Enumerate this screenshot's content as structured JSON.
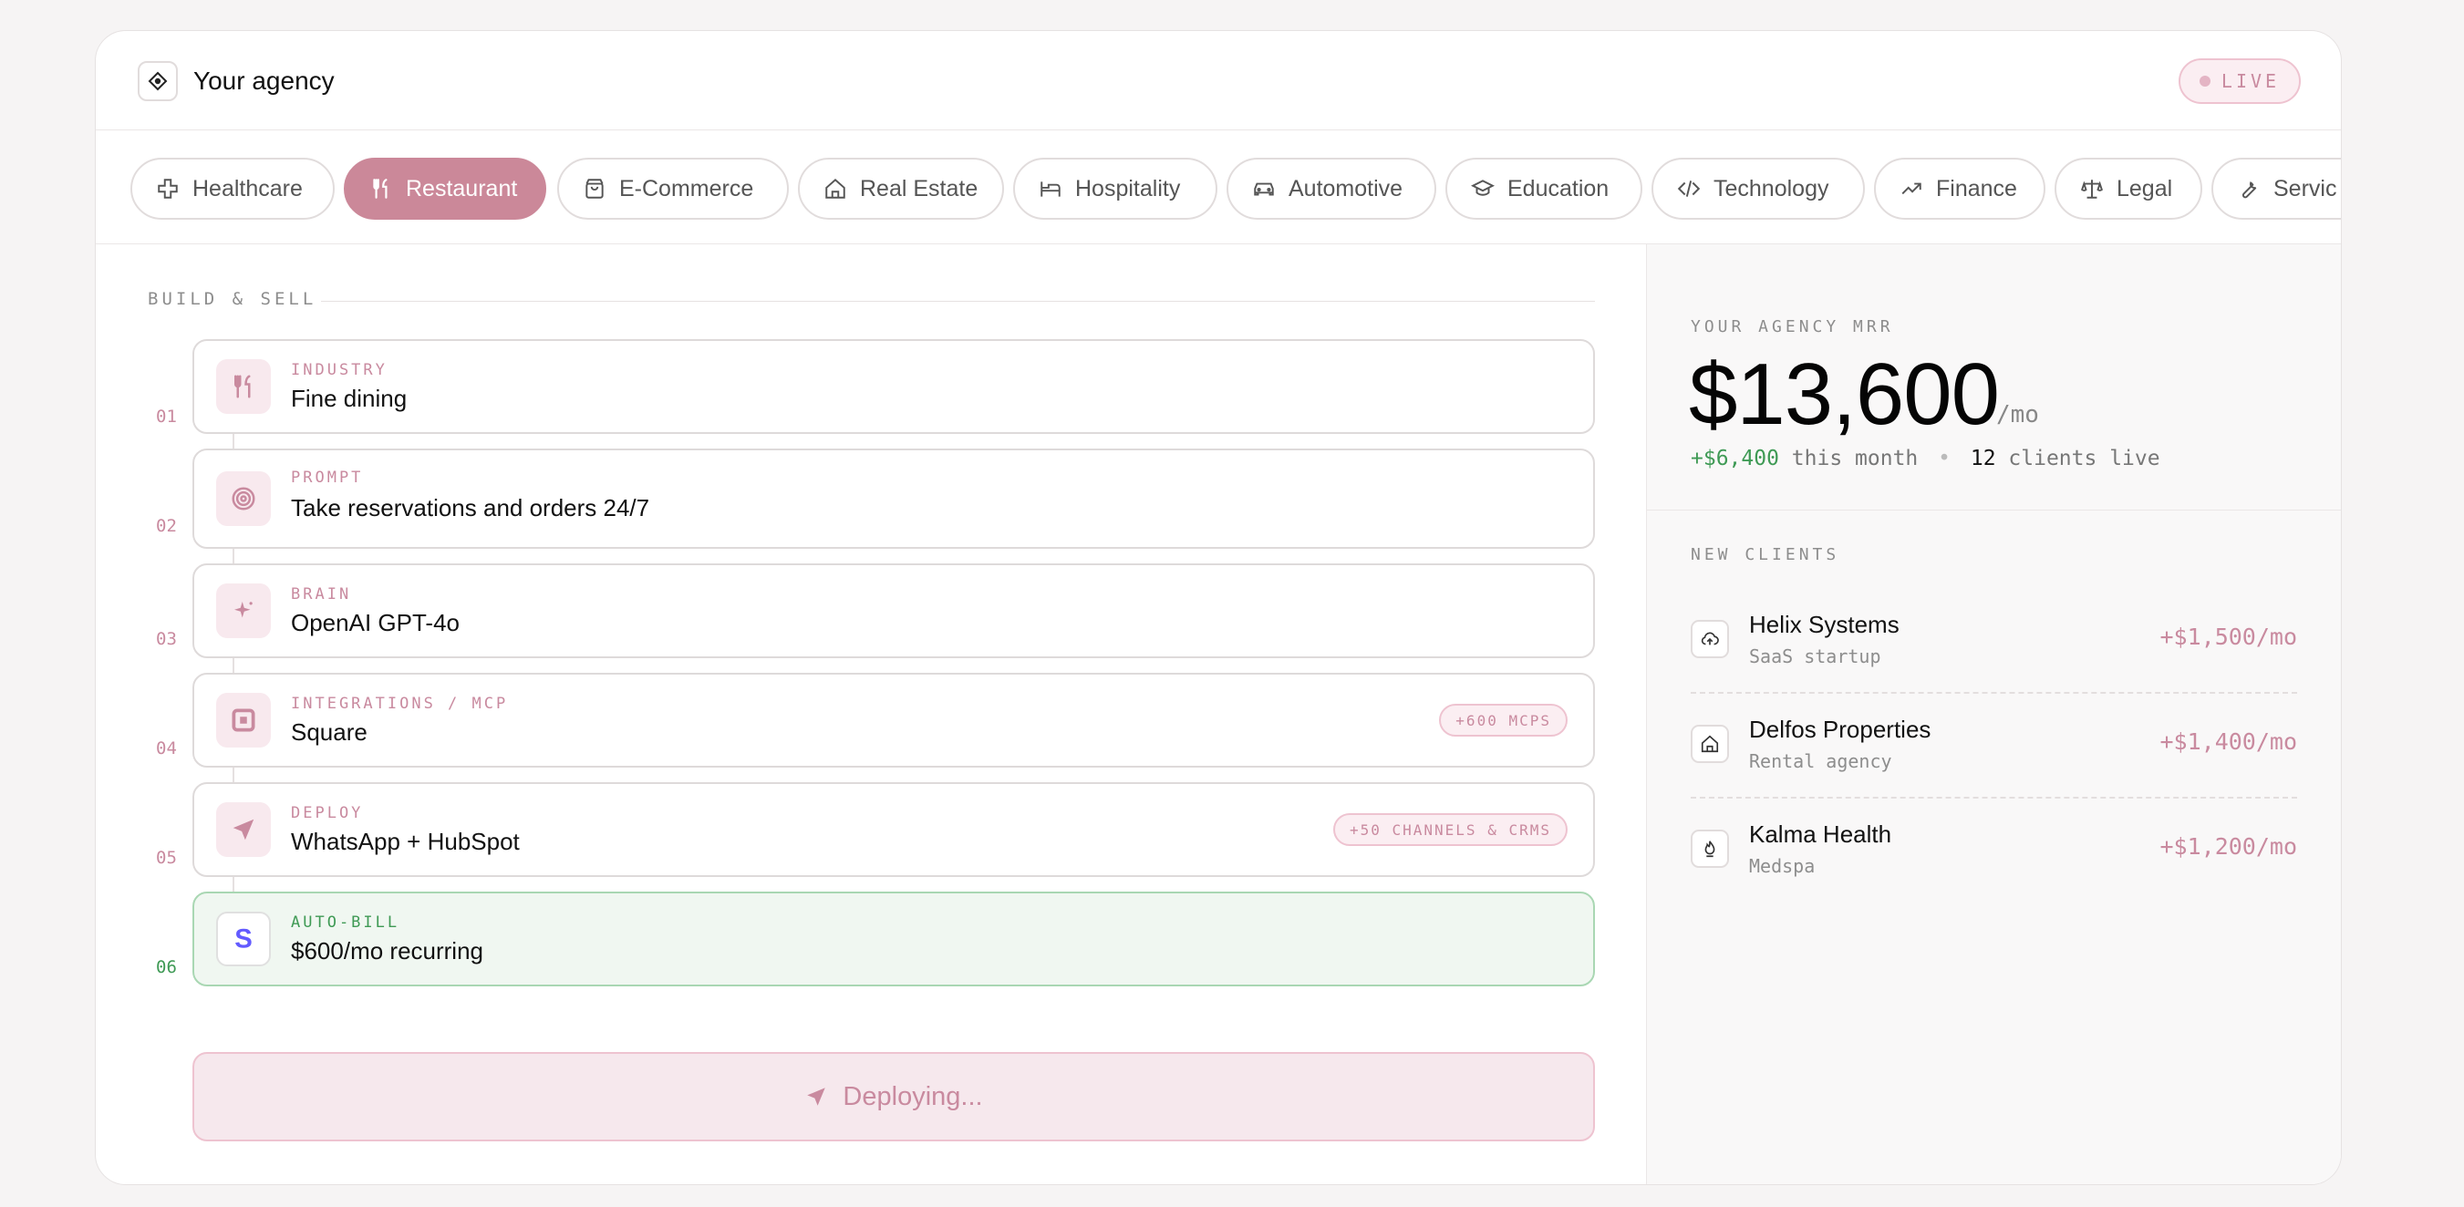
{
  "header": {
    "title": "Your agency",
    "live_label": "LIVE"
  },
  "tabs": [
    {
      "label": "Healthcare",
      "icon": "plus-cross-icon",
      "active": false
    },
    {
      "label": "Restaurant",
      "icon": "utensils-icon",
      "active": true
    },
    {
      "label": "E-Commerce",
      "icon": "shopping-bag-icon",
      "active": false
    },
    {
      "label": "Real Estate",
      "icon": "home-icon",
      "active": false
    },
    {
      "label": "Hospitality",
      "icon": "bed-icon",
      "active": false
    },
    {
      "label": "Automotive",
      "icon": "car-icon",
      "active": false
    },
    {
      "label": "Education",
      "icon": "graduation-cap-icon",
      "active": false
    },
    {
      "label": "Technology",
      "icon": "code-icon",
      "active": false
    },
    {
      "label": "Finance",
      "icon": "trending-up-icon",
      "active": false
    },
    {
      "label": "Legal",
      "icon": "scale-icon",
      "active": false
    },
    {
      "label": "Servic",
      "icon": "wrench-icon",
      "active": false
    }
  ],
  "build": {
    "section_label": "BUILD & SELL",
    "steps": [
      {
        "num": "01",
        "label": "INDUSTRY",
        "value": "Fine dining",
        "icon": "utensils-icon",
        "pill": ""
      },
      {
        "num": "02",
        "label": "PROMPT",
        "value": "Take reservations and orders 24/7",
        "icon": "target-icon",
        "pill": ""
      },
      {
        "num": "03",
        "label": "BRAIN",
        "value": "OpenAI GPT-4o",
        "icon": "sparkle-icon",
        "pill": ""
      },
      {
        "num": "04",
        "label": "INTEGRATIONS / MCP",
        "value": "Square",
        "icon": "square-icon",
        "pill": "+600 MCPS"
      },
      {
        "num": "05",
        "label": "DEPLOY",
        "value": "WhatsApp + HubSpot",
        "icon": "send-icon",
        "pill": "+50 CHANNELS & CRMS"
      },
      {
        "num": "06",
        "label": "AUTO-BILL",
        "value": "$600/mo recurring",
        "icon": "stripe-icon",
        "pill": ""
      }
    ],
    "deploy_button": "Deploying..."
  },
  "mrr": {
    "label": "YOUR AGENCY MRR",
    "value": "$13,600",
    "unit": "/mo",
    "change": "+$6,400",
    "change_suffix": "this month",
    "separator": "•",
    "clients_count": "12",
    "clients_suffix": "clients live"
  },
  "new_clients": {
    "label": "NEW CLIENTS",
    "items": [
      {
        "name": "Helix Systems",
        "type": "SaaS startup",
        "amount": "+$1,500/mo",
        "icon": "cloud-upload-icon"
      },
      {
        "name": "Delfos Properties",
        "type": "Rental agency",
        "amount": "+$1,400/mo",
        "icon": "home-icon"
      },
      {
        "name": "Kalma Health",
        "type": "Medspa",
        "amount": "+$1,200/mo",
        "icon": "flame-icon"
      }
    ]
  },
  "colors": {
    "accent": "#cb8899",
    "accent_text": "#c98a9f",
    "accent_bg": "#fbeef2",
    "green": "#3f9a55",
    "green_bg": "#f0f7f1",
    "stripe": "#635bff"
  }
}
